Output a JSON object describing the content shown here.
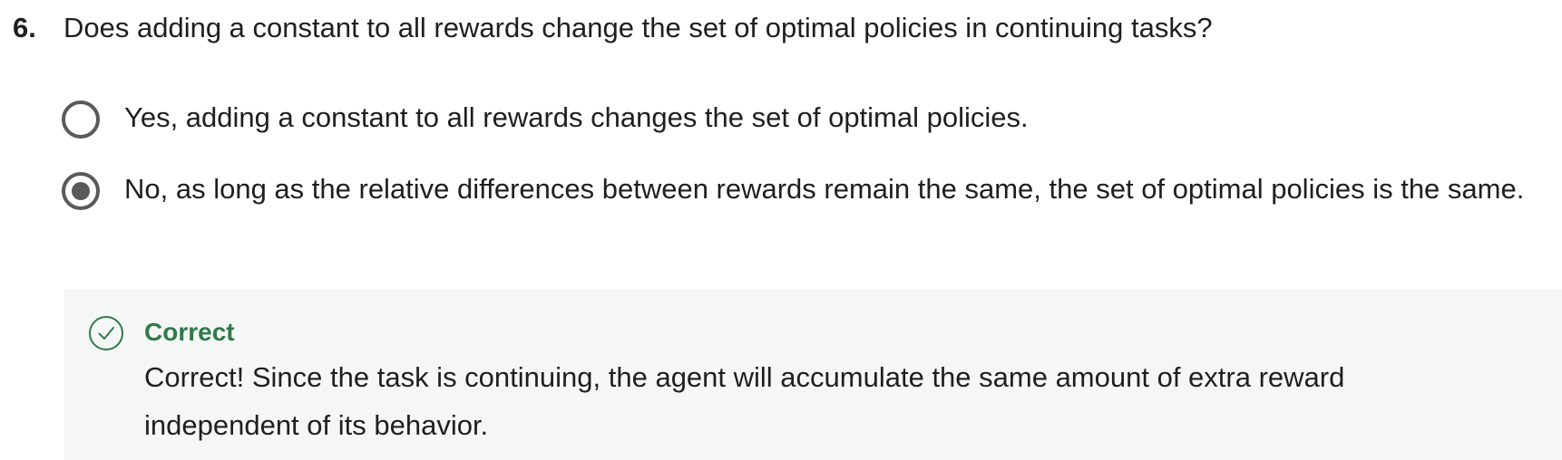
{
  "question": {
    "number": "6.",
    "text": "Does adding a constant to all rewards change the set of optimal policies in continuing tasks?"
  },
  "options": [
    {
      "label": "Yes, adding a constant to all rewards changes the set of optimal policies.",
      "selected": false
    },
    {
      "label": "No, as long as the relative differences between rewards remain the same, the set of optimal policies is the same.",
      "selected": true
    }
  ],
  "feedback": {
    "icon": "check-circle-icon",
    "title": "Correct",
    "text": "Correct! Since the task is continuing, the agent will accumulate the same amount of extra reward independent of its behavior."
  },
  "colors": {
    "radio": "#5a5a5a",
    "correct_green": "#2f7a4a",
    "feedback_bg": "#f5f7f7",
    "text": "#1f1f1f"
  }
}
